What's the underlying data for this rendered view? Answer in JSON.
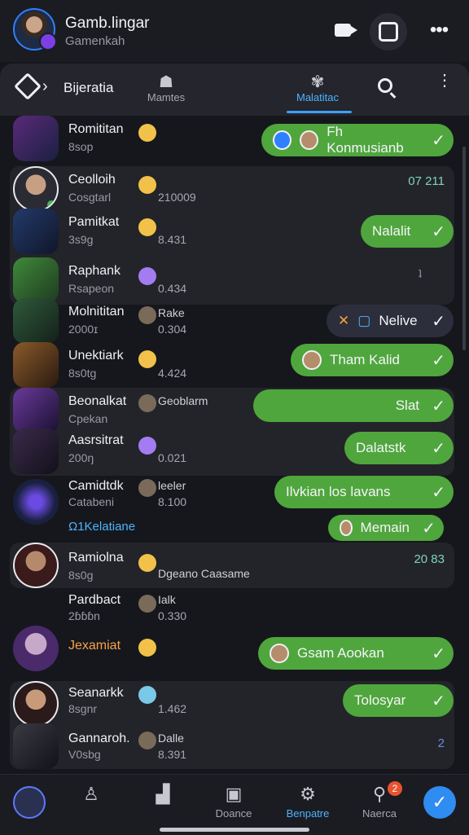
{
  "header": {
    "title": "Gamb.lingar",
    "subtitle": "Gamenkah"
  },
  "tabbar": {
    "group_label": "Bijeratia",
    "tabs": [
      {
        "label": "Mamtes"
      },
      {
        "label": "Malatitac"
      }
    ]
  },
  "chats": [
    {
      "name": "Romititan",
      "sub": "8sop",
      "pill": "Fh Konmusianb"
    },
    {
      "name": "Ceolloih",
      "sub": "Cosgtarl",
      "count": "210009",
      "meta": "07 211"
    },
    {
      "name": "Pamitkat",
      "sub": "3s9g",
      "count": "8.431",
      "pill": "Nalalit"
    },
    {
      "name": "Raphank",
      "sub": "Rsapeon",
      "count": "0.434",
      "meta": "ʇ"
    },
    {
      "name": "Molnititan",
      "sub": "2000ɪ",
      "label2": "Rake",
      "count": "0.304",
      "pill": "Nelive"
    },
    {
      "name": "Unektiark",
      "sub": "8s0tg",
      "count": "4.424",
      "pill": "Tham Kalid"
    },
    {
      "name": "Beonalkat",
      "sub": "Cpekan",
      "label2": "Geoblarm",
      "pill": "Slat"
    },
    {
      "name": "Aasrsitrat",
      "sub": "200ŋ",
      "count": "0.021",
      "pill": "Dalatstk"
    },
    {
      "name": "Camidtdk",
      "sub": "Catabeni",
      "label2": "leeler",
      "count": "8.100",
      "pill": "Ilvkian los lavans"
    },
    {
      "name": "Ramiolna",
      "sub": "8s0g",
      "label2": "Dgeano Caasame",
      "meta": "20 83"
    },
    {
      "name": "Pardbact",
      "sub": "2ɓɓɓn",
      "label2": "Ialk",
      "count": "0.330"
    },
    {
      "name": "Jexamiat",
      "pill": "Gsam Aookan"
    },
    {
      "name": "Seanarkk",
      "sub": "8sgnr",
      "count": "1.462",
      "pill": "Tolosyar"
    },
    {
      "name": "Gannaroh.",
      "sub": "V0sbg",
      "label2": "Dalle",
      "count": "8.391",
      "meta": "2"
    }
  ],
  "section_label": "Ω1Kelatiane",
  "section_pill": "Memain",
  "bottom_nav": {
    "items": [
      {
        "label": ""
      },
      {
        "label": ""
      },
      {
        "label": "Doance"
      },
      {
        "label": "Benpatre"
      },
      {
        "label": "Naerca"
      }
    ],
    "badge": "2"
  },
  "colors": {
    "accent": "#3aa0ff",
    "pill_green": "#4fa63d",
    "background": "#16171c"
  }
}
